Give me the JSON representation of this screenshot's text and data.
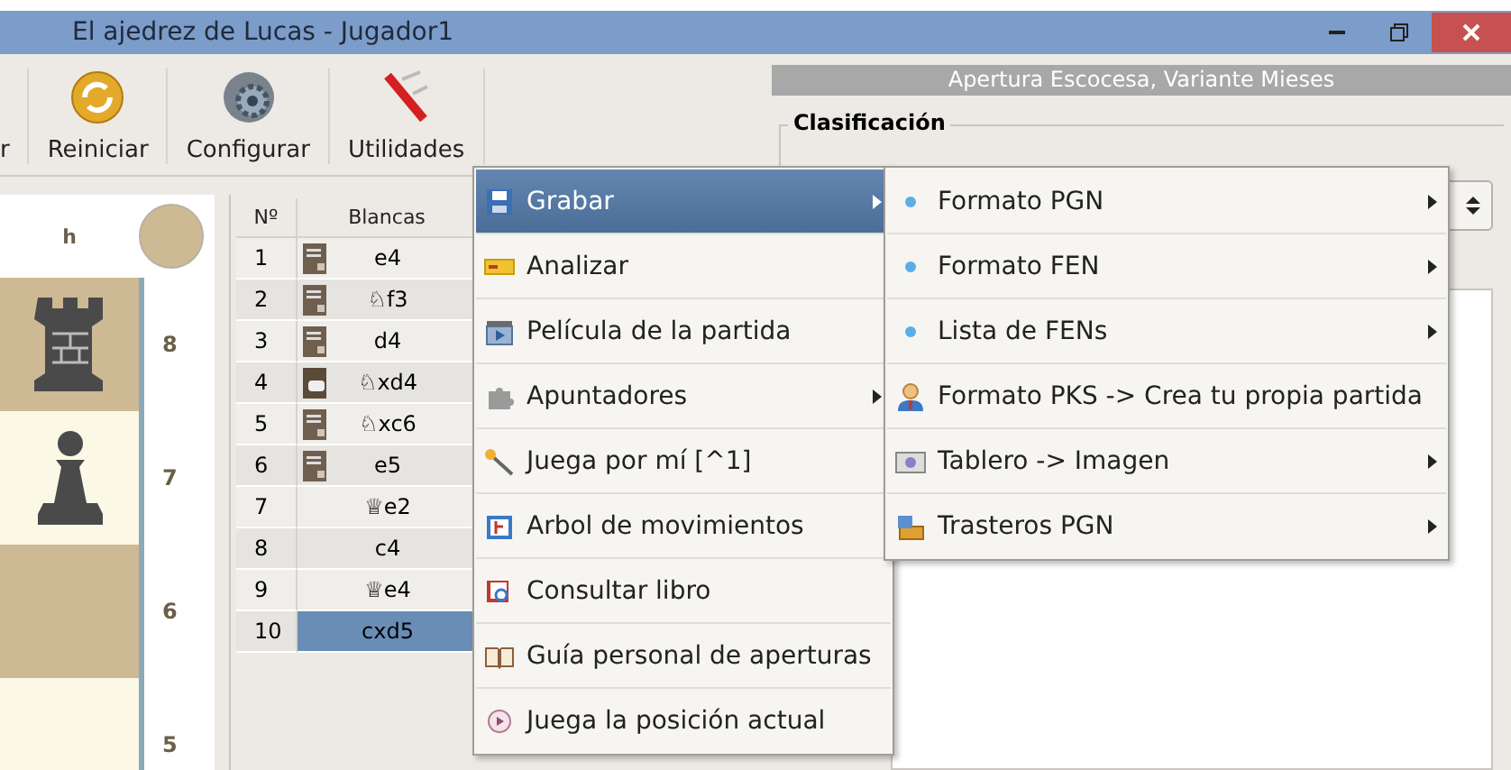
{
  "window": {
    "title": "El ajedrez de Lucas - Jugador1"
  },
  "toolbar": [
    {
      "label": "r",
      "kind": "cut"
    },
    {
      "label": "Reiniciar",
      "kind": "restart"
    },
    {
      "label": "Configurar",
      "kind": "gear"
    },
    {
      "label": "Utilidades",
      "kind": "tools"
    }
  ],
  "board": {
    "file_label": "h",
    "ranks": [
      {
        "label": "8",
        "kind": "rook",
        "light": false
      },
      {
        "label": "7",
        "kind": "pawn",
        "light": true
      },
      {
        "label": "6",
        "kind": "empty",
        "light": false
      },
      {
        "label": "5",
        "kind": "empty",
        "light": true
      }
    ]
  },
  "moves": {
    "columns": [
      "Nº",
      "Blancas"
    ],
    "rows": [
      {
        "no": "1",
        "kind": "book",
        "move": "e4",
        "selected": false
      },
      {
        "no": "2",
        "kind": "book",
        "move": "♘f3",
        "selected": false
      },
      {
        "no": "3",
        "kind": "book",
        "move": "d4",
        "selected": false
      },
      {
        "no": "4",
        "kind": "comment",
        "move": "♘xd4",
        "selected": false
      },
      {
        "no": "5",
        "kind": "book",
        "move": "♘xc6",
        "selected": false
      },
      {
        "no": "6",
        "kind": "book",
        "move": "e5",
        "selected": false
      },
      {
        "no": "7",
        "kind": "plain",
        "move": "♕e2",
        "selected": false
      },
      {
        "no": "8",
        "kind": "plain",
        "move": "c4",
        "selected": false
      },
      {
        "no": "9",
        "kind": "plain",
        "move": "♕e4",
        "selected": false
      },
      {
        "no": "10",
        "kind": "plain",
        "move": "cxd5",
        "selected": true
      }
    ]
  },
  "opening": {
    "title": "Apertura Escocesa, Variante Mieses",
    "group_label": "Clasificación"
  },
  "menu": [
    {
      "label": "Grabar",
      "kind": "save",
      "submenu": true,
      "selected": true
    },
    {
      "label": "Analizar",
      "kind": "analyze",
      "submenu": false,
      "selected": false
    },
    {
      "label": "Película de la partida",
      "kind": "film",
      "submenu": false,
      "selected": false
    },
    {
      "label": "Apuntadores",
      "kind": "puzzle",
      "submenu": true,
      "selected": false
    },
    {
      "label": "Juega por mí  [^1]",
      "kind": "wand",
      "submenu": false,
      "selected": false
    },
    {
      "label": "Arbol de movimientos",
      "kind": "tree",
      "submenu": false,
      "selected": false
    },
    {
      "label": "Consultar libro",
      "kind": "book",
      "submenu": false,
      "selected": false
    },
    {
      "label": "Guía personal de aperturas",
      "kind": "openbook",
      "submenu": false,
      "selected": false
    },
    {
      "label": "Juega la posición actual",
      "kind": "play",
      "submenu": false,
      "selected": false
    }
  ],
  "submenu": [
    {
      "label": "Formato PGN",
      "kind": "dot",
      "submenu": true
    },
    {
      "label": "Formato FEN",
      "kind": "dot",
      "submenu": true
    },
    {
      "label": "Lista de FENs",
      "kind": "dot",
      "submenu": true
    },
    {
      "label": "Formato PKS -> Crea tu propia partida",
      "kind": "person",
      "submenu": false
    },
    {
      "label": "Tablero -> Imagen",
      "kind": "camera",
      "submenu": true
    },
    {
      "label": "Trasteros PGN",
      "kind": "box",
      "submenu": true
    }
  ]
}
